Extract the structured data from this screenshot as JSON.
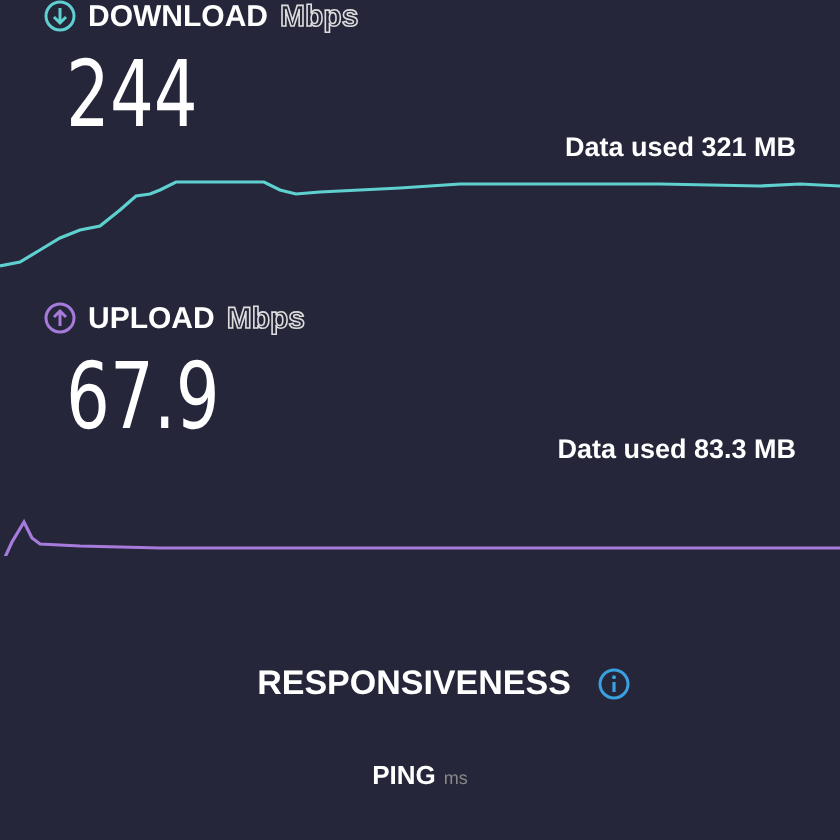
{
  "sections": [
    {
      "kind": "download",
      "title": "DOWNLOAD",
      "unit": "Mbps",
      "value": "244",
      "data_used": "Data used 321 MB"
    },
    {
      "kind": "upload",
      "title": "UPLOAD",
      "unit": "Mbps",
      "value": "67.9",
      "data_used": "Data used 83.3 MB"
    }
  ],
  "responsiveness": {
    "title": "RESPONSIVENESS",
    "next_label": "PING",
    "next_unit": "ms"
  }
}
